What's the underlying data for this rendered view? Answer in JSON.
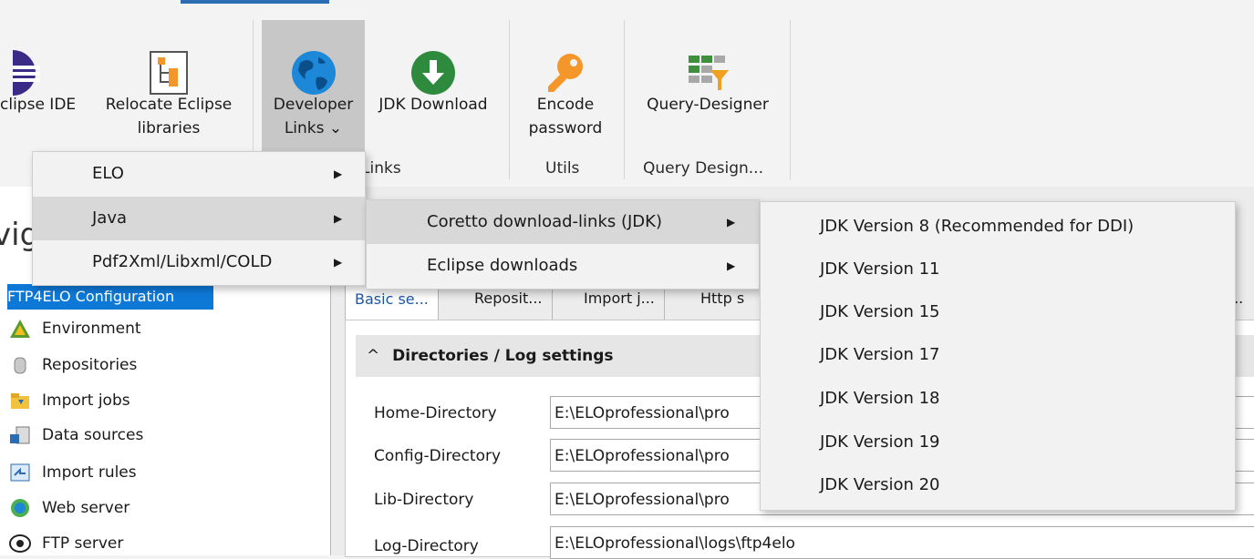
{
  "ribbon": {
    "buttons": {
      "eclipse_ide": "clipse IDE",
      "relocate_1": "Relocate Eclipse",
      "relocate_2": "libraries",
      "dev_links_1": "Developer",
      "dev_links_2": "Links",
      "jdk_download": "JDK Download",
      "encode_1": "Encode",
      "encode_2": "password",
      "query_designer": "Query-Designer"
    },
    "groups": {
      "links": "Links",
      "utils": "Utils",
      "query": "Query Design..."
    },
    "dropdown_glyph": "⌄"
  },
  "nav": {
    "title": "vig",
    "selected": "FTP4ELO Configuration",
    "items": [
      "Environment",
      "Repositories",
      "Import jobs",
      "Data sources",
      "Import rules",
      "Web server",
      "FTP server"
    ]
  },
  "tabs": [
    "Basic se...",
    "Reposit...",
    "Import j...",
    "Http s"
  ],
  "tabs_more": "...",
  "section": {
    "title": "Directories / Log settings",
    "collapse_glyph": "^"
  },
  "fields": [
    {
      "label": "Home-Directory",
      "value": "E:\\ELOprofessional\\pro"
    },
    {
      "label": "Config-Directory",
      "value": "E:\\ELOprofessional\\pro"
    },
    {
      "label": "Lib-Directory",
      "value": "E:\\ELOprofessional\\pro"
    },
    {
      "label": "Log-Directory",
      "value": "E:\\ELOprofessional\\logs\\ftp4elo"
    }
  ],
  "menu1": [
    "ELO",
    "Java",
    "Pdf2Xml/Libxml/COLD"
  ],
  "menu2": [
    "Coretto download-links (JDK)",
    "Eclipse downloads"
  ],
  "menu3": [
    "JDK Version 8 (Recommended for DDI)",
    "JDK Version 11",
    "JDK Version 15",
    "JDK Version 17",
    "JDK Version 18",
    "JDK Version 19",
    "JDK Version 20"
  ],
  "submenu_arrow": "▶",
  "colors": {
    "accent": "#2b6cb3",
    "selection": "#0e78d7",
    "globe": "#1e88d8",
    "download": "#2e8b3e",
    "key": "#f5962a",
    "query_green": "#3f8f3f",
    "query_orange": "#f0a020"
  }
}
